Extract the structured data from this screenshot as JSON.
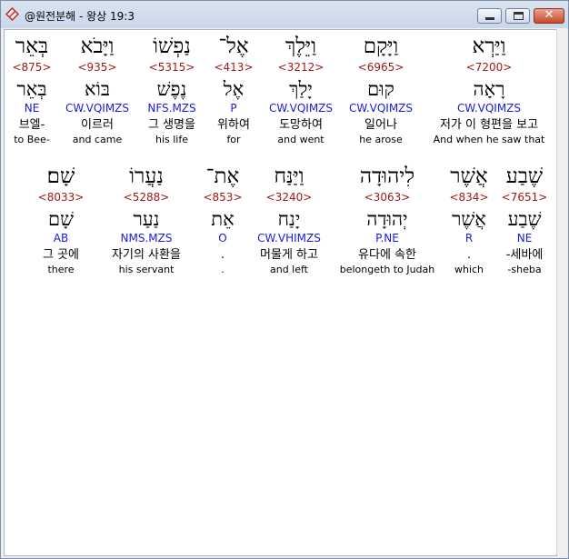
{
  "window": {
    "title": "@원전분해 - 왕상 19:3"
  },
  "colors": {
    "strong_number": "#a01818",
    "morphology": "#1a1adc",
    "text": "#000000",
    "selected_background": "#ffffff",
    "panel_background": "#f0f0f0"
  },
  "icons": {
    "app": "red-diamond-icon",
    "minimize": "minimize-icon",
    "maximize": "maximize-icon",
    "close": "close-icon"
  },
  "rows": [
    {
      "words": [
        {
          "hebrew": "בְּאֵר",
          "strong": "<875>",
          "lemma": "בְּאֵר",
          "morph": "NE",
          "korean": "브엘-",
          "english": "to Bee-",
          "selected": false
        },
        {
          "hebrew": "וַיָּבֹא",
          "strong": "<935>",
          "lemma": "בּוֹא",
          "morph": "CW.VQIMZS",
          "korean": "이르러",
          "english": "and came",
          "selected": false
        },
        {
          "hebrew": "נַפְשׁוֹ",
          "strong": "<5315>",
          "lemma": "נֶפֶשׁ",
          "morph": "NFS.MZS",
          "korean": "그 생명을",
          "english": "his life",
          "selected": false
        },
        {
          "hebrew": "אֶל־",
          "strong": "<413>",
          "lemma": "אֶל",
          "morph": "P",
          "korean": "위하여",
          "english": "for",
          "selected": false
        },
        {
          "hebrew": "וַיֵּלֶךְ",
          "strong": "<3212>",
          "lemma": "יָלַךְ",
          "morph": "CW.VQIMZS",
          "korean": "도망하여",
          "english": "and went",
          "selected": false
        },
        {
          "hebrew": "וַיָּקָם",
          "strong": "<6965>",
          "lemma": "קוּם",
          "morph": "CW.VQIMZS",
          "korean": "일어나",
          "english": "he arose",
          "selected": false
        },
        {
          "hebrew": "וַיַּרְא",
          "strong": "<7200>",
          "lemma": "רָאָה",
          "morph": "CW.VQIMZS",
          "korean": "저가 이 형편을 보고",
          "english": "And when he saw that",
          "selected": true
        }
      ]
    },
    {
      "words": [
        {
          "hebrew": "שָׁם׃",
          "strong": "<8033>",
          "lemma": "שָׁם",
          "morph": "AB",
          "korean": "그 곳에",
          "english": "there",
          "selected": false
        },
        {
          "hebrew": "נַעֲרוֹ",
          "strong": "<5288>",
          "lemma": "נַעַר",
          "morph": "NMS.MZS",
          "korean": "자기의 사환을",
          "english": "his servant",
          "selected": false
        },
        {
          "hebrew": "אֶת־",
          "strong": "<853>",
          "lemma": "אֵת",
          "morph": "O",
          "korean": ".",
          "english": ".",
          "selected": false
        },
        {
          "hebrew": "וַיַּנַּח",
          "strong": "<3240>",
          "lemma": "יָנַח",
          "morph": "CW.VHIMZS",
          "korean": "머물게 하고",
          "english": "and left",
          "selected": false
        },
        {
          "hebrew": "לִיהוּדָה",
          "strong": "<3063>",
          "lemma": "יְהוּדָה",
          "morph": "P.NE",
          "korean": "유다에 속한",
          "english": "belongeth to Judah",
          "selected": false
        },
        {
          "hebrew": "אֲשֶׁר",
          "strong": "<834>",
          "lemma": "אֲשֶׁר",
          "morph": "R",
          "korean": ".",
          "english": "which",
          "selected": false
        },
        {
          "hebrew": "שֶׁבַע",
          "strong": "<7651>",
          "lemma": "שֶׁבַע",
          "morph": "NE",
          "korean": "-세바에",
          "english": "-sheba",
          "selected": false
        }
      ]
    }
  ]
}
